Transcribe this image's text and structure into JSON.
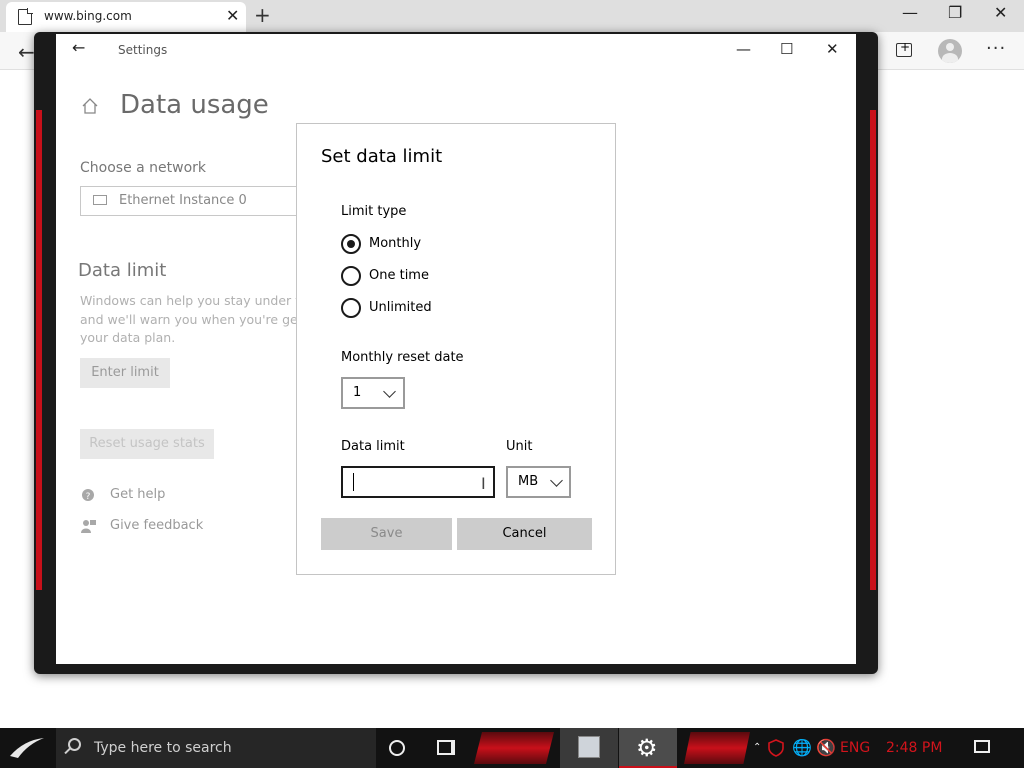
{
  "browser": {
    "tab_title": "www.bing.com",
    "close_tab": "✕",
    "new_tab": "+",
    "minimize": "—",
    "maximize": "❐",
    "close": "✕",
    "back": "←",
    "more": "···"
  },
  "settings_window": {
    "title": "Settings",
    "back": "←",
    "minimize": "—",
    "maximize": "☐",
    "close": "✕",
    "page_heading": "Data usage",
    "choose_network_label": "Choose a network",
    "network_value": "Ethernet Instance 0",
    "data_limit_heading": "Data limit",
    "data_limit_desc_lines": [
      "Windows can help you stay under y",
      "and we'll warn you when you're get",
      "your data plan."
    ],
    "enter_limit_label": "Enter limit",
    "reset_stats_label": "Reset usage stats",
    "get_help_label": "Get help",
    "give_feedback_label": "Give feedback"
  },
  "dialog": {
    "title": "Set data limit",
    "limit_type_label": "Limit type",
    "options": [
      "Monthly",
      "One time",
      "Unlimited"
    ],
    "selected_option": "Monthly",
    "reset_date_label": "Monthly reset date",
    "reset_date_value": "1",
    "data_limit_label": "Data limit",
    "data_limit_value": "",
    "unit_label": "Unit",
    "unit_value": "MB",
    "save_label": "Save",
    "cancel_label": "Cancel"
  },
  "taskbar": {
    "search_placeholder": "Type here to search",
    "language": "ENG",
    "time": "2:48 PM"
  },
  "colors": {
    "accent_red": "#c8101a",
    "taskbar_bg": "#121212"
  },
  "icons": [
    "page-icon",
    "home-icon",
    "monitor-icon",
    "help-icon",
    "feedback-icon",
    "search-icon",
    "gear-icon",
    "shield-icon",
    "globe-icon",
    "speaker-muted-icon",
    "notification-icon"
  ]
}
